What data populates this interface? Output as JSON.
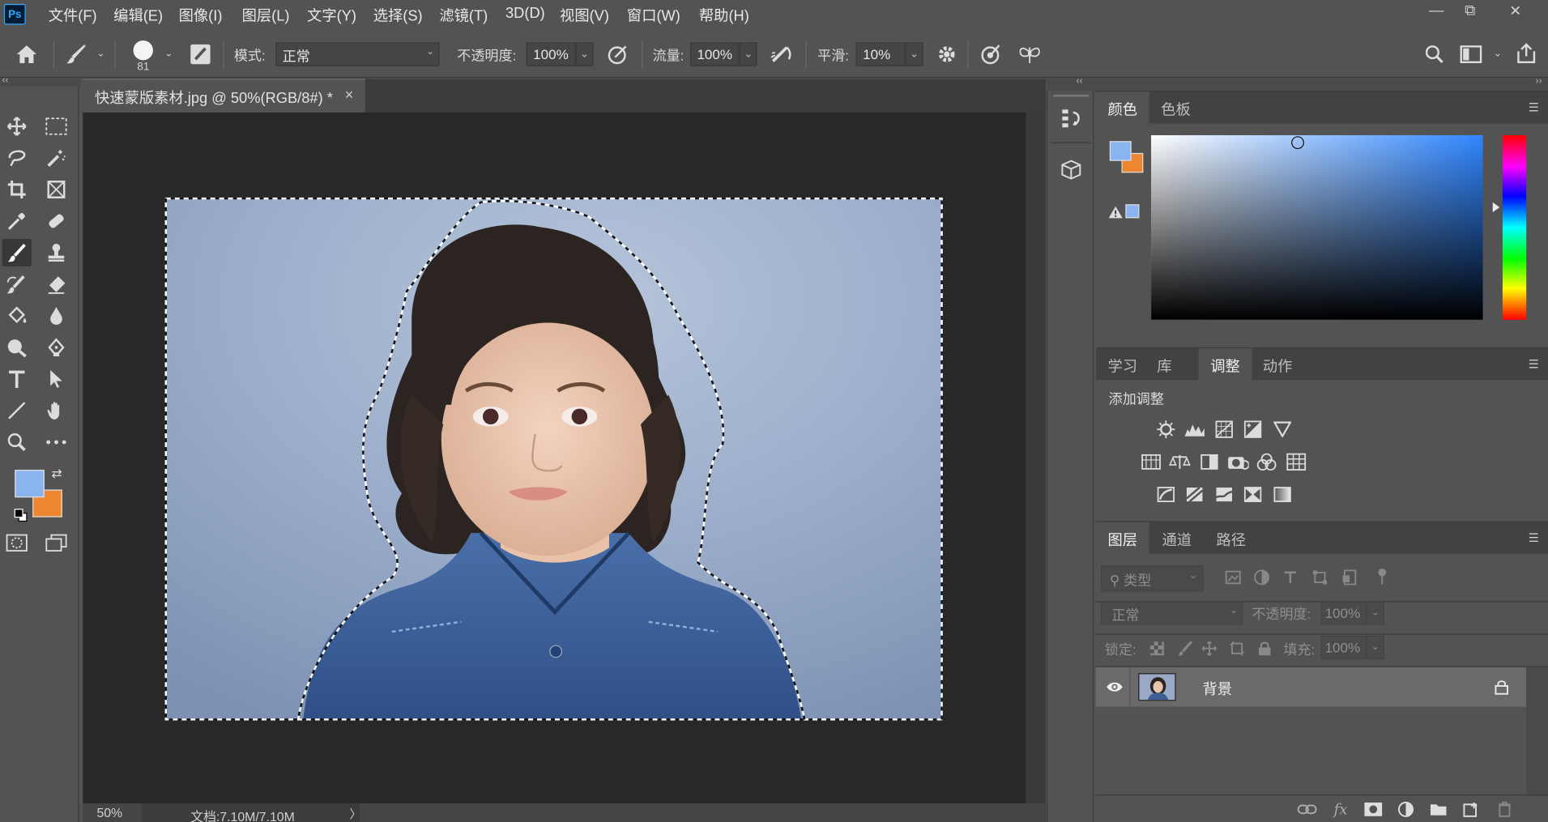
{
  "app": {
    "logo": "Ps"
  },
  "menu": {
    "items": [
      "文件(F)",
      "编辑(E)",
      "图像(I)",
      "图层(L)",
      "文字(Y)",
      "选择(S)",
      "滤镜(T)",
      "3D(D)",
      "视图(V)",
      "窗口(W)",
      "帮助(H)"
    ]
  },
  "window": {
    "minimize": "—",
    "restore": "⧉",
    "close": "✕"
  },
  "options": {
    "brush_size": "81",
    "mode_label": "模式:",
    "mode_value": "正常",
    "opacity_label": "不透明度:",
    "opacity_value": "100%",
    "flow_label": "流量:",
    "flow_value": "100%",
    "smoothing_label": "平滑:",
    "smoothing_value": "10%"
  },
  "document": {
    "tab_title": "快速蒙版素材.jpg @ 50%(RGB/8#) *",
    "tab_close": "×",
    "zoom": "50%",
    "doc_size": "文档:7.10M/7.10M",
    "status_arrow": "〉"
  },
  "colors": {
    "foreground": "#8ab4f0",
    "background": "#ee8530",
    "picker_hue": "#2f86ff"
  },
  "color_panel": {
    "tabs": [
      "颜色",
      "色板"
    ],
    "active_tab": "颜色"
  },
  "adjust_panel": {
    "tabs": [
      "学习",
      "库",
      "调整",
      "动作"
    ],
    "active_tab": "调整",
    "title": "添加调整"
  },
  "layers_panel": {
    "tabs": [
      "图层",
      "通道",
      "路径"
    ],
    "active_tab": "图层",
    "filter_placeholder": "类型",
    "blend_mode": "正常",
    "opacity_label": "不透明度:",
    "opacity_value": "100%",
    "lock_label": "锁定:",
    "fill_label": "填充:",
    "fill_value": "100%",
    "layers": [
      {
        "name": "背景",
        "visible": true,
        "locked": true
      }
    ]
  }
}
